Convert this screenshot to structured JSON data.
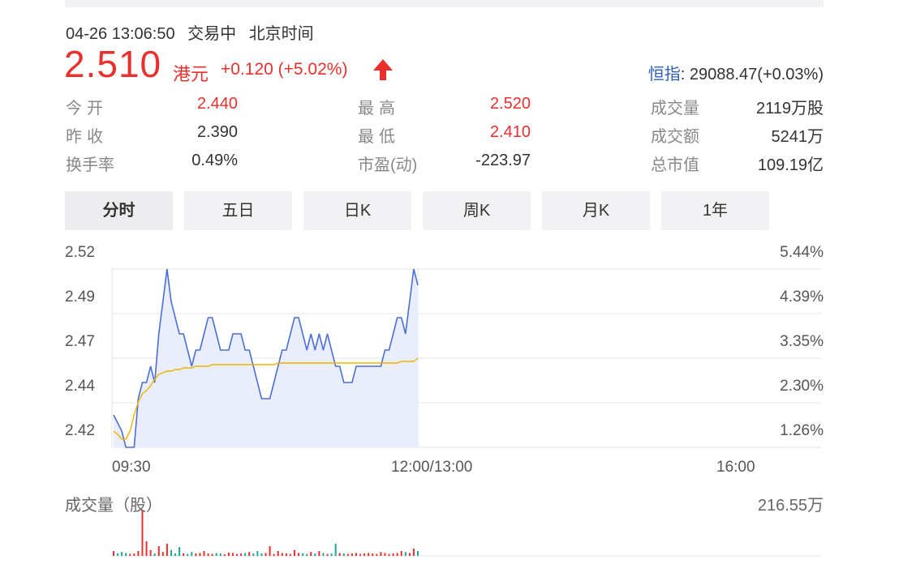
{
  "header": {
    "datetime": "04-26 13:06:50",
    "trading_status": "交易中",
    "timezone": "北京时间",
    "price": "2.510",
    "currency": "港元",
    "change": "+0.120 (+5.02%)",
    "index_name": "恒指",
    "index_value": ": 29088.47(+0.03%)"
  },
  "stats": [
    {
      "label": "今开",
      "value": "2.440",
      "color": "#e9302d"
    },
    {
      "label": "最高",
      "value": "2.520",
      "color": "#e9302d"
    },
    {
      "label": "成交量",
      "value": "2119万股",
      "color": "#333333"
    },
    {
      "label": "昨收",
      "value": "2.390",
      "color": "#333333"
    },
    {
      "label": "最低",
      "value": "2.410",
      "color": "#e9302d"
    },
    {
      "label": "成交额",
      "value": "5241万",
      "color": "#333333"
    },
    {
      "label": "换手率",
      "value": "0.49%",
      "color": "#333333"
    },
    {
      "label": "市盈(动)",
      "value": "-223.97",
      "color": "#333333"
    },
    {
      "label": "总市值",
      "value": "109.19亿",
      "color": "#333333"
    }
  ],
  "tabs": [
    {
      "label": "分时",
      "active": true
    },
    {
      "label": "五日",
      "active": false
    },
    {
      "label": "日K",
      "active": false
    },
    {
      "label": "周K",
      "active": false
    },
    {
      "label": "月K",
      "active": false
    },
    {
      "label": "1年",
      "active": false
    }
  ],
  "chart_data": {
    "type": "line",
    "y_price_ticks": [
      "2.52",
      "2.49",
      "2.47",
      "2.44",
      "2.42"
    ],
    "y_pct_ticks": [
      "5.44%",
      "4.39%",
      "3.35%",
      "2.30%",
      "1.26%"
    ],
    "x_ticks": [
      "09:30",
      "12:00/13:00",
      "16:00"
    ],
    "ylim": [
      2.41,
      2.52
    ],
    "series": [
      {
        "color": "#4a6fd8",
        "values": [
          2.43,
          2.425,
          2.42,
          2.41,
          2.41,
          2.41,
          2.44,
          2.45,
          2.45,
          2.46,
          2.45,
          2.48,
          2.5,
          2.52,
          2.5,
          2.49,
          2.48,
          2.48,
          2.47,
          2.46,
          2.47,
          2.47,
          2.48,
          2.49,
          2.49,
          2.48,
          2.47,
          2.47,
          2.47,
          2.48,
          2.48,
          2.48,
          2.47,
          2.47,
          2.46,
          2.45,
          2.44,
          2.44,
          2.44,
          2.45,
          2.46,
          2.47,
          2.47,
          2.48,
          2.49,
          2.49,
          2.48,
          2.47,
          2.48,
          2.47,
          2.48,
          2.47,
          2.48,
          2.47,
          2.46,
          2.46,
          2.45,
          2.45,
          2.45,
          2.46,
          2.46,
          2.46,
          2.46,
          2.46,
          2.46,
          2.46,
          2.47,
          2.47,
          2.48,
          2.49,
          2.49,
          2.48,
          2.5,
          2.52,
          2.51
        ]
      },
      {
        "color": "#f0b400",
        "values": [
          2.42,
          2.418,
          2.415,
          2.415,
          2.42,
          2.43,
          2.438,
          2.443,
          2.445,
          2.448,
          2.452,
          2.455,
          2.456,
          2.457,
          2.457,
          2.458,
          2.458,
          2.459,
          2.459,
          2.459,
          2.46,
          2.46,
          2.46,
          2.46,
          2.461,
          2.461,
          2.461,
          2.461,
          2.461,
          2.461,
          2.461,
          2.461,
          2.461,
          2.461,
          2.461,
          2.461,
          2.461,
          2.461,
          2.461,
          2.461,
          2.462,
          2.462,
          2.462,
          2.462,
          2.462,
          2.462,
          2.462,
          2.462,
          2.462,
          2.462,
          2.462,
          2.462,
          2.462,
          2.462,
          2.462,
          2.462,
          2.462,
          2.462,
          2.462,
          2.462,
          2.462,
          2.462,
          2.462,
          2.462,
          2.462,
          2.462,
          2.462,
          2.462,
          2.462,
          2.462,
          2.463,
          2.463,
          2.463,
          2.463,
          2.465
        ]
      }
    ]
  },
  "volume": {
    "title": "成交量（股）",
    "max_label": "216.55万",
    "values": [
      0.1,
      0.05,
      0.08,
      0.06,
      0.04,
      0.05,
      0.1,
      0.95,
      0.3,
      0.12,
      0.05,
      0.2,
      0.08,
      0.25,
      0.12,
      0.05,
      0.18,
      0.05,
      0.04,
      0.08,
      0.05,
      0.06,
      0.1,
      0.05,
      0.04,
      0.06,
      0.05,
      0.03,
      0.07,
      0.06,
      0.04,
      0.05,
      0.06,
      0.08,
      0.05,
      0.1,
      0.05,
      0.06,
      0.2,
      0.04,
      0.1,
      0.06,
      0.05,
      0.04,
      0.12,
      0.06,
      0.05,
      0.04,
      0.08,
      0.05,
      0.1,
      0.06,
      0.04,
      0.05,
      0.25,
      0.06,
      0.05,
      0.04,
      0.05,
      0.06,
      0.04,
      0.05,
      0.06,
      0.05,
      0.04,
      0.08,
      0.06,
      0.04,
      0.05,
      0.06,
      0.1,
      0.08,
      0.06,
      0.15,
      0.1
    ]
  },
  "colors": {
    "up": "#e9302d",
    "down": "#1aa89a",
    "price_line": "#4a6fd8",
    "avg_line": "#f0b400",
    "area": "#e8ebfb"
  }
}
